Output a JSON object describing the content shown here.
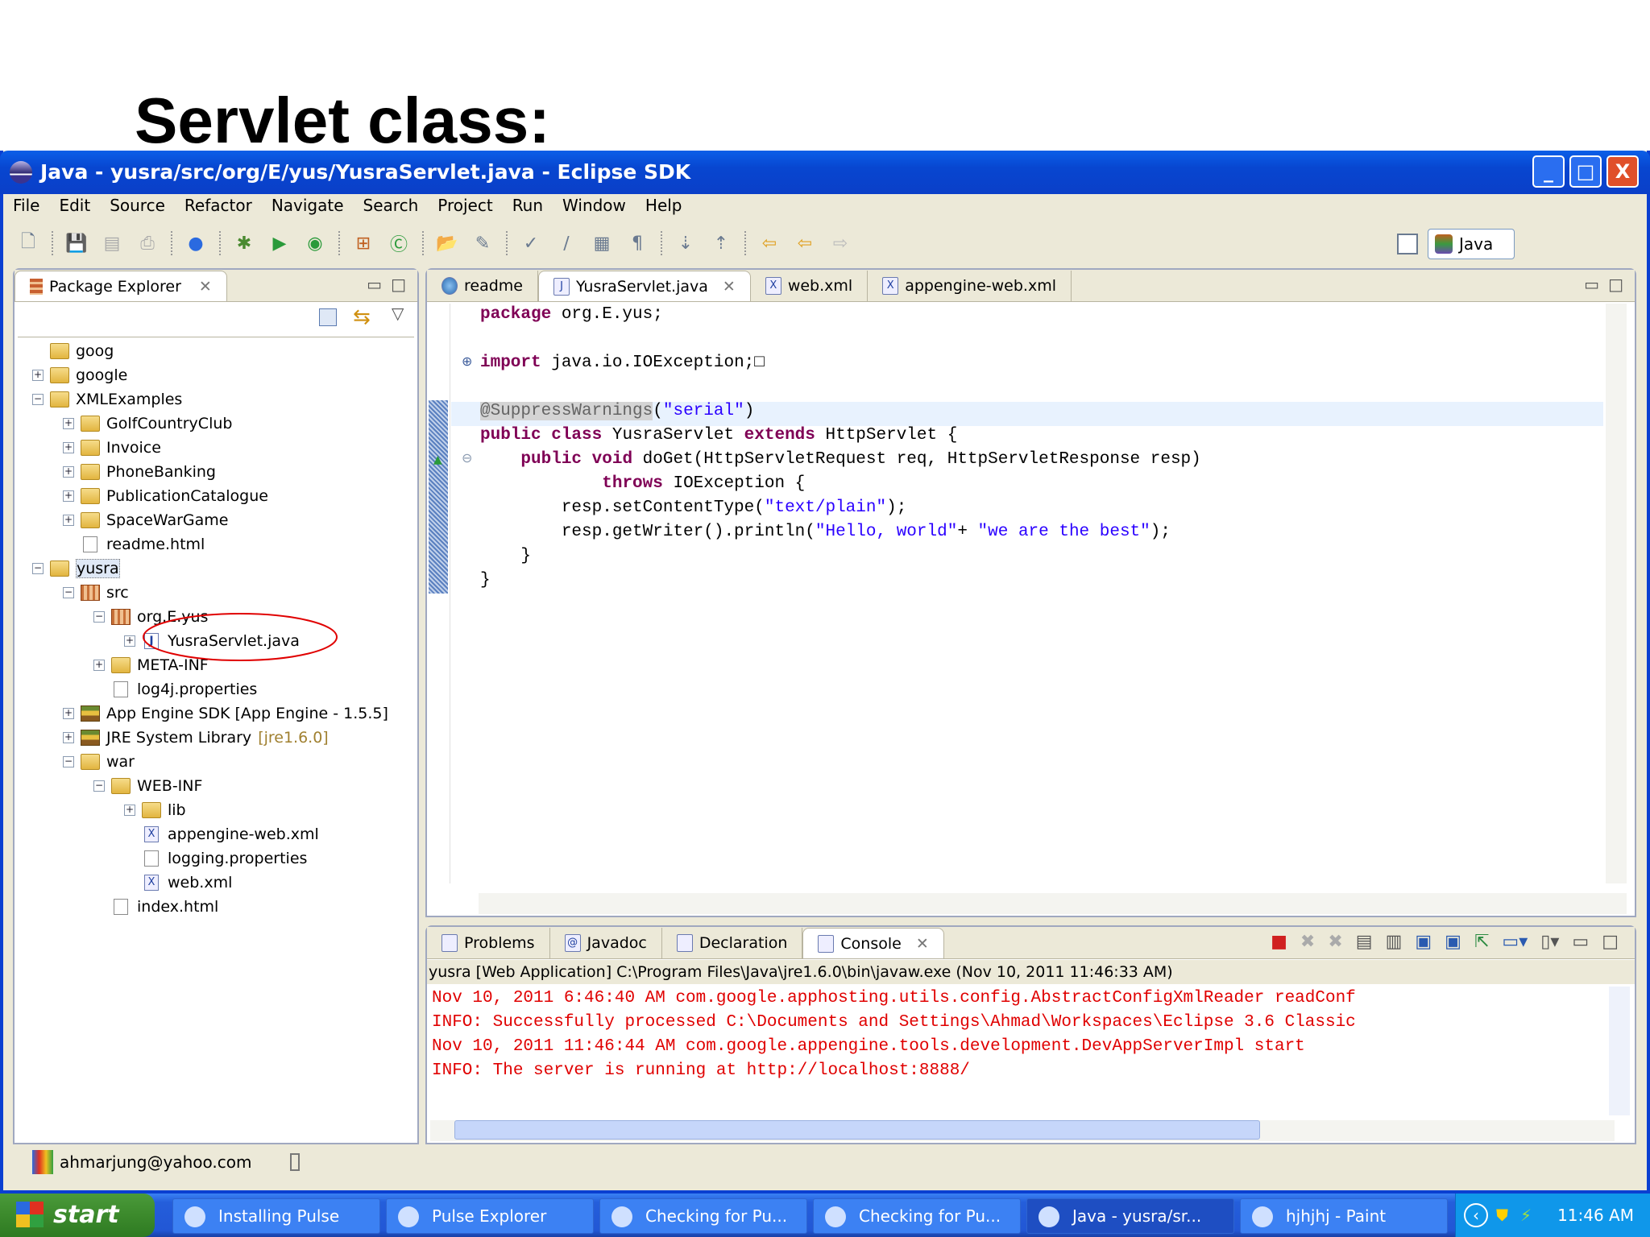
{
  "slide_title": "Servlet class:",
  "window": {
    "title": "Java - yusra/src/org/E/yus/YusraServlet.java - Eclipse SDK",
    "minimize": "_",
    "maximize": "□",
    "close": "X"
  },
  "menu": [
    "File",
    "Edit",
    "Source",
    "Refactor",
    "Navigate",
    "Search",
    "Project",
    "Run",
    "Window",
    "Help"
  ],
  "toolbar": {
    "perspective_label": "Java",
    "icons": [
      "new-wizard-icon",
      "save-icon",
      "save-all-icon",
      "print-icon",
      "google-icon",
      "debug-icon",
      "run-icon",
      "external-tools-icon",
      "new-package-icon",
      "new-class-icon",
      "open-type-icon",
      "search-icon",
      "toggle-mark-icon",
      "annotation-icon",
      "block-select-icon",
      "show-whitespace-icon",
      "next-annotation-icon",
      "previous-annotation-icon",
      "last-edit-icon",
      "back-icon",
      "forward-icon"
    ]
  },
  "package_explorer": {
    "tab_label": "Package Explorer",
    "tree": [
      {
        "label": "goog",
        "level": 0,
        "exp": "",
        "icon": "folder"
      },
      {
        "label": "google",
        "level": 0,
        "exp": "+",
        "icon": "folder"
      },
      {
        "label": "XMLExamples",
        "level": 0,
        "exp": "-",
        "icon": "folder"
      },
      {
        "label": "GolfCountryClub",
        "level": 1,
        "exp": "+",
        "icon": "folder"
      },
      {
        "label": "Invoice",
        "level": 1,
        "exp": "+",
        "icon": "folder"
      },
      {
        "label": "PhoneBanking",
        "level": 1,
        "exp": "+",
        "icon": "folder"
      },
      {
        "label": "PublicationCatalogue",
        "level": 1,
        "exp": "+",
        "icon": "folder"
      },
      {
        "label": "SpaceWarGame",
        "level": 1,
        "exp": "+",
        "icon": "folder"
      },
      {
        "label": "readme.html",
        "level": 1,
        "exp": "",
        "icon": "file"
      },
      {
        "label": "yusra",
        "level": 0,
        "exp": "-",
        "icon": "folder",
        "selected": true
      },
      {
        "label": "src",
        "level": 1,
        "exp": "-",
        "icon": "pkg"
      },
      {
        "label": "org.E.yus",
        "level": 2,
        "exp": "-",
        "icon": "pkg"
      },
      {
        "label": "YusraServlet.java",
        "level": 3,
        "exp": "+",
        "icon": "java"
      },
      {
        "label": "META-INF",
        "level": 2,
        "exp": "+",
        "icon": "folder"
      },
      {
        "label": "log4j.properties",
        "level": 2,
        "exp": "",
        "icon": "file"
      },
      {
        "label": "App Engine SDK [App Engine - 1.5.5]",
        "level": 1,
        "exp": "+",
        "icon": "lib"
      },
      {
        "label": "JRE System Library",
        "suffix": "[jre1.6.0]",
        "level": 1,
        "exp": "+",
        "icon": "lib"
      },
      {
        "label": "war",
        "level": 1,
        "exp": "-",
        "icon": "folder"
      },
      {
        "label": "WEB-INF",
        "level": 2,
        "exp": "-",
        "icon": "folder"
      },
      {
        "label": "lib",
        "level": 3,
        "exp": "+",
        "icon": "folder"
      },
      {
        "label": "appengine-web.xml",
        "level": 3,
        "exp": "",
        "icon": "xml"
      },
      {
        "label": "logging.properties",
        "level": 3,
        "exp": "",
        "icon": "file"
      },
      {
        "label": "web.xml",
        "level": 3,
        "exp": "",
        "icon": "xml"
      },
      {
        "label": "index.html",
        "level": 2,
        "exp": "",
        "icon": "file"
      }
    ]
  },
  "editor": {
    "tabs": [
      {
        "label": "readme",
        "icon": "globe"
      },
      {
        "label": "YusraServlet.java",
        "icon": "java",
        "active": true
      },
      {
        "label": "web.xml",
        "icon": "xml"
      },
      {
        "label": "appengine-web.xml",
        "icon": "xml"
      }
    ],
    "lines": [
      [
        [
          "kw",
          "package"
        ],
        [
          "t",
          " org.E.yus;"
        ]
      ],
      [],
      [
        [
          "kw",
          "import"
        ],
        [
          "t",
          " java.io.IOException;"
        ],
        [
          "t",
          "□"
        ]
      ],
      [],
      [
        [
          "ann",
          "@SuppressWarnings"
        ],
        [
          "t",
          "("
        ],
        [
          "str",
          "\"serial\""
        ],
        [
          "t",
          ")"
        ]
      ],
      [
        [
          "kw",
          "public class"
        ],
        [
          "t",
          " YusraServlet "
        ],
        [
          "kw",
          "extends"
        ],
        [
          "t",
          " HttpServlet {"
        ]
      ],
      [
        [
          "t",
          "    "
        ],
        [
          "kw",
          "public void"
        ],
        [
          "t",
          " doGet(HttpServletRequest req, HttpServletResponse resp)"
        ]
      ],
      [
        [
          "t",
          "            "
        ],
        [
          "kw",
          "throws"
        ],
        [
          "t",
          " IOException {"
        ]
      ],
      [
        [
          "t",
          "        resp.setContentType("
        ],
        [
          "str",
          "\"text/plain\""
        ],
        [
          "t",
          ");"
        ]
      ],
      [
        [
          "t",
          "        resp.getWriter().println("
        ],
        [
          "str",
          "\"Hello, world\""
        ],
        [
          "t",
          "+ "
        ],
        [
          "str",
          "\"we are the best\""
        ],
        [
          "t",
          ");"
        ]
      ],
      [
        [
          "t",
          "    }"
        ]
      ],
      [
        [
          "t",
          "}"
        ]
      ]
    ]
  },
  "bottom": {
    "tabs": [
      {
        "label": "Problems"
      },
      {
        "label": "Javadoc"
      },
      {
        "label": "Declaration"
      },
      {
        "label": "Console",
        "active": true
      }
    ],
    "console_header": "yusra [Web Application] C:\\Program Files\\Java\\jre1.6.0\\bin\\javaw.exe (Nov 10, 2011 11:46:33 AM)",
    "console_lines": [
      "Nov 10, 2011 6:46:40 AM com.google.apphosting.utils.config.AbstractConfigXmlReader readConf",
      "INFO: Successfully processed C:\\Documents and Settings\\Ahmad\\Workspaces\\Eclipse 3.6 Classic",
      "Nov 10, 2011 11:46:44 AM com.google.appengine.tools.development.DevAppServerImpl start",
      "INFO: The server is running at http://localhost:8888/"
    ]
  },
  "status": {
    "account": "ahmarjung@yahoo.com"
  },
  "taskbar": {
    "start": "start",
    "tasks": [
      {
        "label": "Installing Pulse"
      },
      {
        "label": "Pulse Explorer"
      },
      {
        "label": "Checking for Pu..."
      },
      {
        "label": "Checking for Pu..."
      },
      {
        "label": "Java - yusra/sr...",
        "active": true
      },
      {
        "label": "hjhjhj - Paint"
      }
    ],
    "clock": "11:46 AM"
  },
  "colors": {
    "keyword": "#7f0055",
    "string": "#2a00ff",
    "console": "#e00000",
    "annotation_circle": "#e00000"
  }
}
